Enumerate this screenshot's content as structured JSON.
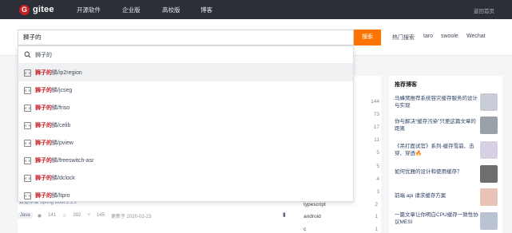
{
  "header": {
    "logo_text": "gitee",
    "nav": [
      "开源软件",
      "企业版",
      "高校版",
      "博客"
    ],
    "login": "返回首页"
  },
  "search": {
    "query": "狮子的",
    "button": "搜索",
    "hot_label": "热门搜索",
    "hot_terms": [
      "taro",
      "swoole",
      "Wechat"
    ]
  },
  "dropdown": {
    "query_suggestion": "狮子的",
    "items": [
      {
        "keyword": "狮子的",
        "rest": "鳞/ip2region"
      },
      {
        "keyword": "狮子的",
        "rest": "鳞/jcseg"
      },
      {
        "keyword": "狮子的",
        "rest": "鳞/friso"
      },
      {
        "keyword": "狮子的",
        "rest": "鳞/celib"
      },
      {
        "keyword": "狮子的",
        "rest": "鳞/pview"
      },
      {
        "keyword": "狮子的",
        "rest": "鳞/freeswitch-asr"
      },
      {
        "keyword": "狮子的",
        "rest": "鳞/dclock"
      },
      {
        "keyword": "狮子的",
        "rest": "鳞/ltpro"
      }
    ]
  },
  "languages": {
    "counts": [
      "144",
      "73",
      "17",
      "11",
      "5",
      "5",
      "4",
      "3",
      "2"
    ],
    "rows": [
      {
        "name": "typescript",
        "count": "2"
      },
      {
        "name": "android",
        "count": "1"
      },
      {
        "name": "c",
        "count": "1"
      }
    ]
  },
  "sidebar": {
    "title": "推荐博客",
    "blogs": [
      {
        "title": "马蜂窝推荐系统容灾缓存服务的设计与实现",
        "thumb": "#c7ccd6"
      },
      {
        "title": "你与解决“缓存污染”只差这篇文章的距离",
        "thumb": "#9aa0a8"
      },
      {
        "title": "《吊打面试官》系列-缓存雪崩、击穿、穿透🔥",
        "thumb": "#d7cfe3"
      },
      {
        "title": "如何优雅的设计和使用缓存？",
        "thumb": "#6e6e70"
      },
      {
        "title": "前端 api 请求缓存方案",
        "thumb": "#e8c2b4"
      },
      {
        "title": "一篇文章让你明白CPU缓存一致性协议MESI",
        "thumb": "#b9c3d1"
      }
    ]
  },
  "repo": {
    "tags_partial": "数据存储    Spring Boot 2.1.x",
    "language": "Java",
    "watch": "141",
    "star": "392",
    "fork": "145",
    "updated": "更新于 2020-02-23"
  }
}
